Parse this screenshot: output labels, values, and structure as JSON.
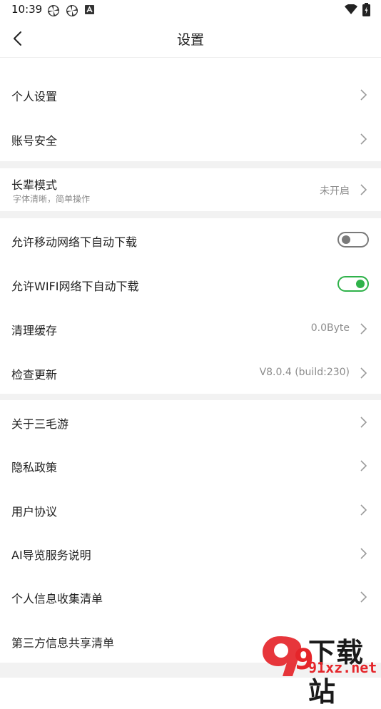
{
  "status_bar": {
    "time": "10:39"
  },
  "header": {
    "title": "设置"
  },
  "section1": [
    {
      "label": "个人设置"
    },
    {
      "label": "账号安全"
    }
  ],
  "elder_mode": {
    "label": "长辈模式",
    "subtitle": "字体清晰，简单操作",
    "value": "未开启"
  },
  "section3": {
    "mobile_download": {
      "label": "允许移动网络下自动下载",
      "enabled": false
    },
    "wifi_download": {
      "label": "允许WIFI网络下自动下载",
      "enabled": true
    },
    "clear_cache": {
      "label": "清理缓存",
      "value": "0.0Byte"
    },
    "check_update": {
      "label": "检查更新",
      "value": "V8.0.4 (build:230)"
    }
  },
  "section4": [
    {
      "label": "关于三毛游"
    },
    {
      "label": "隐私政策"
    },
    {
      "label": "用户协议"
    },
    {
      "label": "AI导览服务说明"
    },
    {
      "label": "个人信息收集清单"
    },
    {
      "label": "第三方信息共享清单"
    }
  ],
  "watermark": {
    "logo_glyph": "9",
    "title": "下载站",
    "url": "91xz.net"
  },
  "colors": {
    "toggle_on": "#2fb24a",
    "toggle_off": "#7a7a7a",
    "section_gap": "#f2f2f2"
  }
}
